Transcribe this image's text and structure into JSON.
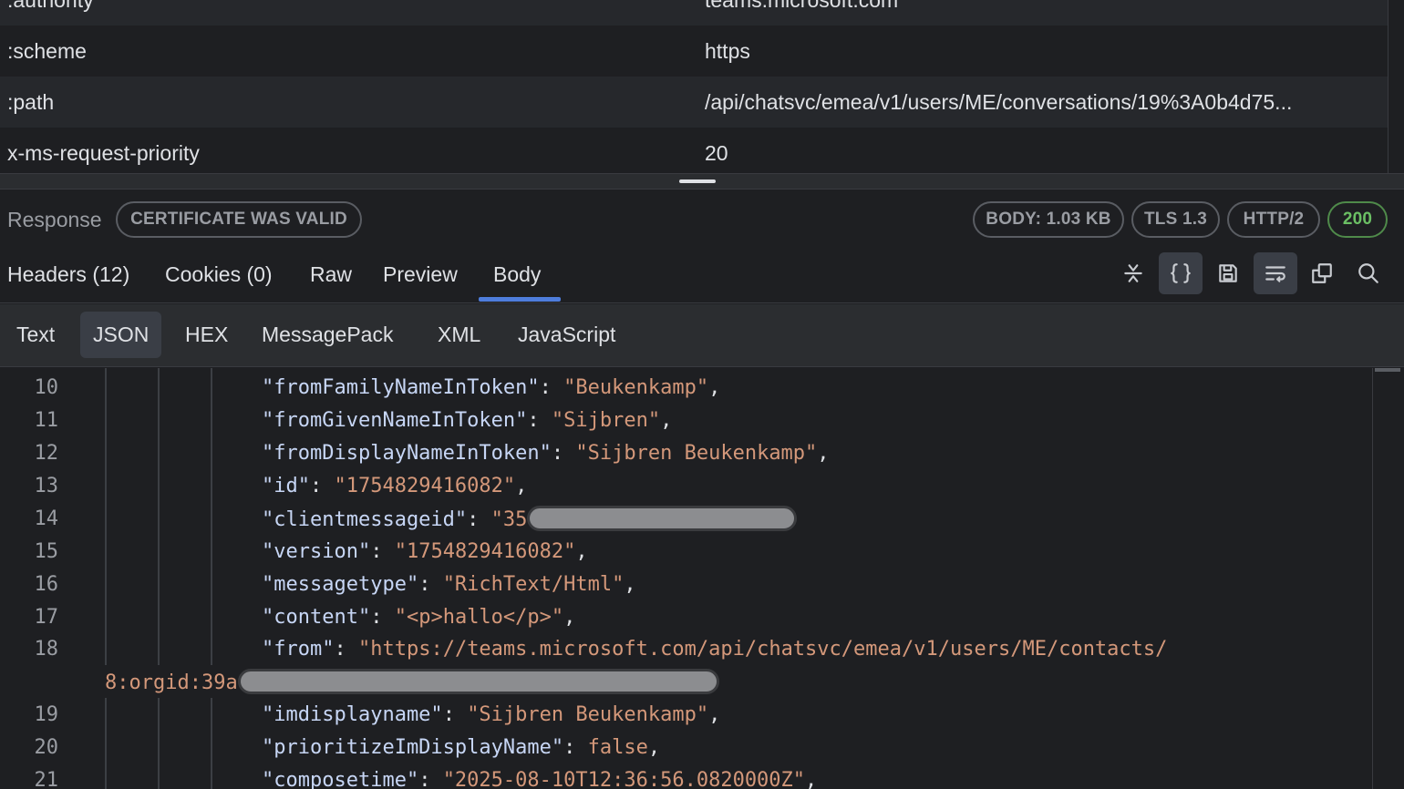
{
  "request_headers": [
    {
      "key": ":authority",
      "value": "teams.microsoft.com"
    },
    {
      "key": ":scheme",
      "value": "https"
    },
    {
      "key": ":path",
      "value": "/api/chatsvc/emea/v1/users/ME/conversations/19%3A0b4d75..."
    },
    {
      "key": "x-ms-request-priority",
      "value": "20"
    }
  ],
  "response": {
    "title": "Response",
    "certificate": "CERTIFICATE WAS VALID",
    "body_size": "BODY: 1.03 KB",
    "tls": "TLS 1.3",
    "protocol": "HTTP/2",
    "status": "200",
    "status_color": "#6bbf64"
  },
  "tabs": [
    "Headers (12)",
    "Cookies (0)",
    "Raw",
    "Preview",
    "Body"
  ],
  "active_tab": "Body",
  "toolbar_icons": [
    "collapse-icon",
    "format-json-icon",
    "save-icon",
    "wrap-icon",
    "copy-icon",
    "search-icon"
  ],
  "format_tabs": [
    "Text",
    "JSON",
    "HEX",
    "MessagePack",
    "XML",
    "JavaScript"
  ],
  "active_format": "JSON",
  "accent_color": "#4e7ddc",
  "code_lines": [
    {
      "n": "10",
      "key": "\"fromFamilyNameInToken\"",
      "val": "\"Beukenkamp\"",
      "end": ","
    },
    {
      "n": "11",
      "key": "\"fromGivenNameInToken\"",
      "val": "\"Sijbren\"",
      "end": ","
    },
    {
      "n": "12",
      "key": "\"fromDisplayNameInToken\"",
      "val": "\"Sijbren Beukenkamp\"",
      "end": ","
    },
    {
      "n": "13",
      "key": "\"id\"",
      "val": "\"1754829416082\"",
      "end": ","
    },
    {
      "n": "14",
      "key": "\"clientmessageid\"",
      "val": "\"35",
      "end": ""
    },
    {
      "n": "15",
      "key": "\"version\"",
      "val": "\"1754829416082\"",
      "end": ","
    },
    {
      "n": "16",
      "key": "\"messagetype\"",
      "val": "\"RichText/Html\"",
      "end": ","
    },
    {
      "n": "17",
      "key": "\"content\"",
      "val": "\"<p>hallo</p>\"",
      "end": ","
    },
    {
      "n": "18",
      "key": "\"from\"",
      "val": "\"https://teams.microsoft.com/api/chatsvc/emea/v1/users/ME/contacts/",
      "end": ""
    },
    {
      "n": "",
      "key": "",
      "val": "8:orgid:39a",
      "end": ""
    },
    {
      "n": "19",
      "key": "\"imdisplayname\"",
      "val": "\"Sijbren Beukenkamp\"",
      "end": ","
    },
    {
      "n": "20",
      "key": "\"prioritizeImDisplayName\"",
      "val": "false",
      "end": ","
    },
    {
      "n": "21",
      "key": "\"composetime\"",
      "val": "\"2025-08-10T12:36:56.0820000Z\"",
      "end": ","
    }
  ]
}
